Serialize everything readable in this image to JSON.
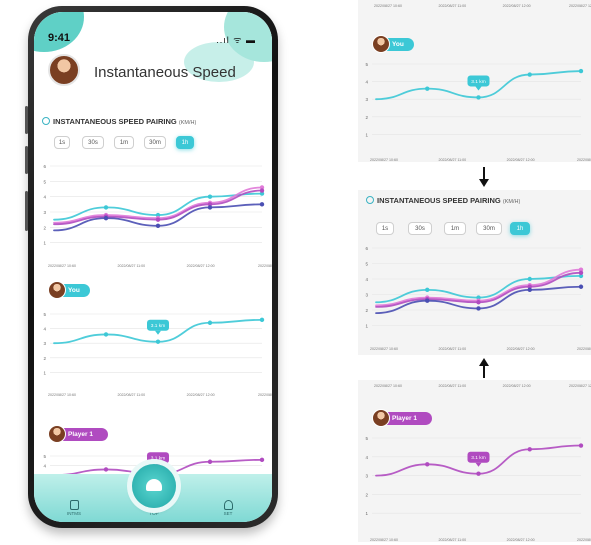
{
  "status_bar": {
    "time": "9:41",
    "icons": "..ıl ᯤ ▬"
  },
  "app": {
    "title": "Instantaneous Speed"
  },
  "speed_section": {
    "title": "INSTANTANEOUS SPEED PAIRING",
    "unit": "(KM/H)",
    "time_buttons": [
      "1s",
      "30s",
      "1m",
      "30m",
      "1h"
    ],
    "active_button": "1h"
  },
  "players": {
    "you": {
      "label": "You",
      "speed_bubble": "3.1 km"
    },
    "player1": {
      "label": "Player 1",
      "speed_bubble": "3.1 km"
    }
  },
  "nav": {
    "left_label": "INTMS",
    "center_label": "TOP",
    "right_label": "SET"
  },
  "colors": {
    "teal": "#3cc8d6",
    "purple": "#b04bc0",
    "navy": "#4a4fb3",
    "pink": "#e07ad8"
  },
  "chart_data": [
    {
      "type": "line",
      "title": "INSTANTANEOUS SPEED PAIRING",
      "ylabel": "(KM/H)",
      "ylim": [
        0,
        6
      ],
      "yticks": [
        1,
        2,
        3,
        4,
        5,
        6
      ],
      "categories": [
        "2022/08/27 10:60",
        "2022/08/27 11:00",
        "2022/08/27 12:00",
        "2022/08/27 12:"
      ],
      "x": [
        0,
        1,
        2,
        3,
        4
      ],
      "series": [
        {
          "color": "#3cc8d6",
          "values": [
            2.5,
            3.3,
            2.8,
            4.0,
            4.2
          ]
        },
        {
          "color": "#e07ad8",
          "values": [
            2.3,
            2.8,
            2.6,
            3.6,
            4.6
          ]
        },
        {
          "color": "#b04bc0",
          "values": [
            2.2,
            2.7,
            2.5,
            3.5,
            4.4
          ]
        },
        {
          "color": "#4a4fb3",
          "values": [
            1.8,
            2.6,
            2.1,
            3.3,
            3.5
          ]
        }
      ]
    },
    {
      "type": "line",
      "title": "You",
      "ylim": [
        0,
        5
      ],
      "yticks": [
        1,
        2,
        3,
        4,
        5
      ],
      "categories": [
        "2022/08/27 10:60",
        "2022/08/27 11:00",
        "2022/08/27 12:00",
        "2022/08/27 12:"
      ],
      "x": [
        0,
        1,
        2,
        3,
        4
      ],
      "series": [
        {
          "color": "#3cc8d6",
          "values": [
            3.0,
            3.6,
            3.1,
            4.4,
            4.6
          ]
        }
      ],
      "annotation": "3.1 km"
    },
    {
      "type": "line",
      "title": "Player 1",
      "ylim": [
        0,
        5
      ],
      "yticks": [
        1,
        2,
        3,
        4,
        5
      ],
      "categories": [
        "2022/08/27 10:60",
        "2022/08/27 11:00",
        "2022/08/27 12:00",
        "2022/08/27 12:"
      ],
      "x": [
        0,
        1,
        2,
        3,
        4
      ],
      "series": [
        {
          "color": "#b04bc0",
          "values": [
            3.0,
            3.6,
            3.1,
            4.4,
            4.6
          ]
        }
      ],
      "annotation": "3.1 km"
    }
  ]
}
